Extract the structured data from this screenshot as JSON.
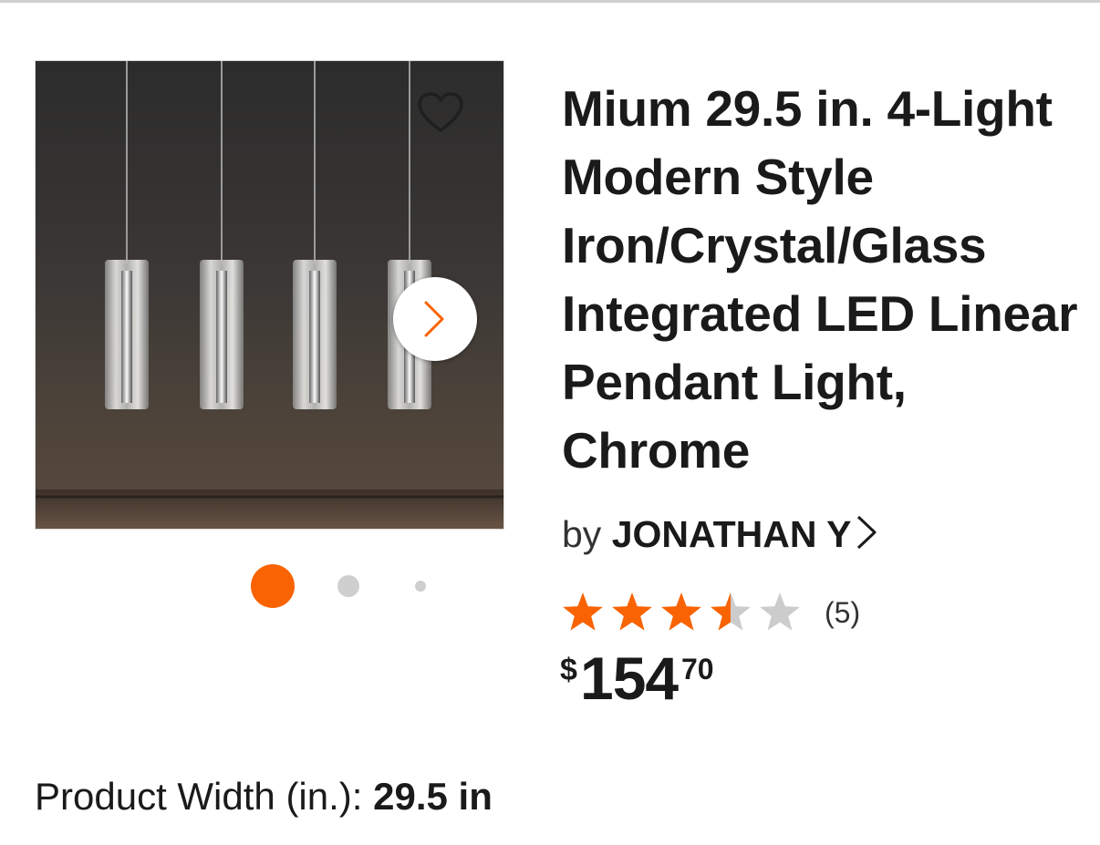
{
  "product": {
    "title": "Mium 29.5 in. 4-Light Modern Style Iron/Crystal/Glass Integrated LED Linear Pendant Light, Chrome",
    "brand_prefix": "by",
    "brand": "JONATHAN Y",
    "rating": 3.5,
    "rating_max": 5,
    "review_count": "(5)",
    "price": {
      "currency": "$",
      "dollars": "154",
      "cents": "70"
    },
    "spec": {
      "label": "Product Width (in.):",
      "value": "29.5 in"
    }
  },
  "gallery": {
    "image_count": 3,
    "active_index": 0,
    "icons": {
      "favorite": "heart-outline-icon",
      "next": "chevron-right-icon",
      "brand_link": "chevron-right-icon"
    }
  },
  "colors": {
    "accent": "#f96302",
    "star_filled": "#f96302",
    "star_empty": "#cccccc",
    "text": "#1a1a1a"
  }
}
